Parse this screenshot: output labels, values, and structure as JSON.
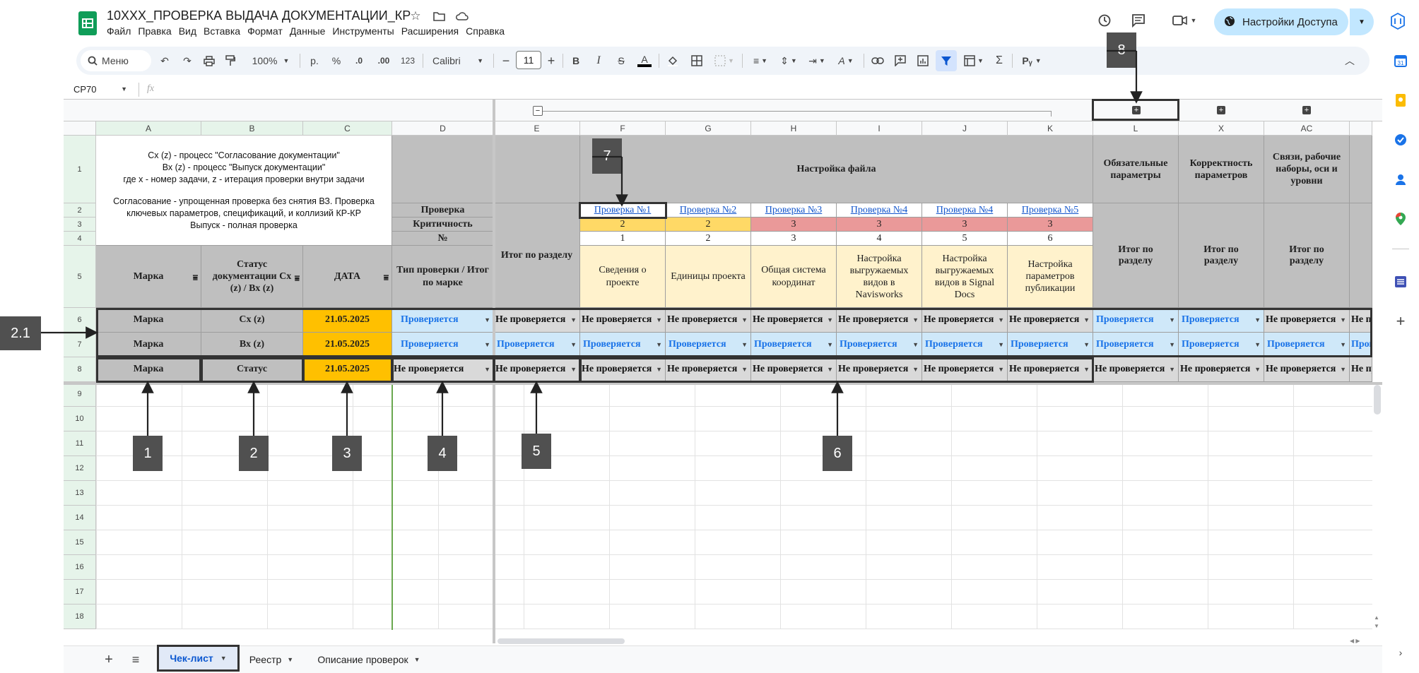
{
  "app": {
    "title": "10ХХХ_ПРОВЕРКА ВЫДАЧА ДОКУМЕНТАЦИИ_КР",
    "menu": [
      "Файл",
      "Правка",
      "Вид",
      "Вставка",
      "Формат",
      "Данные",
      "Инструменты",
      "Расширения",
      "Справка"
    ],
    "share_label": "Настройки Доступа",
    "colors": {
      "accent": "#1a73e8",
      "share_bg": "#c2e7ff",
      "sheets_green": "#0f9d58"
    }
  },
  "toolbar": {
    "search": "Меню",
    "zoom": "100%",
    "currency": "р.",
    "percent": "%",
    "dec_minus": ".0",
    "dec_plus": ".00",
    "num_format": "123",
    "font": "Calibri",
    "font_size": "11"
  },
  "formula_bar": {
    "cell_ref": "CP70",
    "fx": "fx"
  },
  "columns": [
    "A",
    "B",
    "C",
    "D",
    "E",
    "F",
    "G",
    "H",
    "I",
    "J",
    "K",
    "L",
    "X",
    "AC"
  ],
  "rows": [
    "1",
    "2",
    "3",
    "4",
    "5",
    "6",
    "7",
    "8",
    "9",
    "10",
    "11",
    "12",
    "13",
    "14",
    "15",
    "16",
    "17",
    "18"
  ],
  "legend": {
    "line1": "Сх (z) - процесс \"Согласование документации\"",
    "line2": "Вх (z) - процесс \"Выпуск документации\"",
    "line3": "где х - номер задачи, z - итерация проверки внутри задачи",
    "line4": "Согласование - упрощенная проверка без снятия ВЗ. Проверка ключевых параметров, спецификаций, и коллизий КР-КР",
    "line5": "Выпуск - полная проверка"
  },
  "labels": {
    "check": "Проверка",
    "criticality": "Критичность",
    "number": "№",
    "section_total": "Итог по разделу"
  },
  "headers": {
    "marka": "Марка",
    "status": "Статус документации Сх (z) / Вх (z)",
    "date": "ДАТА",
    "check_type": "Тип проверки / Итог по марке"
  },
  "section": {
    "file_setup": "Настройка файла",
    "required": "Обязательные параметры",
    "correct": "Корректность параметров",
    "links": "Связи, рабочие наборы, оси и уровни"
  },
  "checks": [
    {
      "link": "Проверка №1",
      "crit": "2",
      "num": "1",
      "name": "Сведения о проекте"
    },
    {
      "link": "Проверка №2",
      "crit": "2",
      "num": "2",
      "name": "Единицы проекта"
    },
    {
      "link": "Проверка №3",
      "crit": "3",
      "num": "3",
      "name": "Общая система координат"
    },
    {
      "link": "Проверка №4",
      "crit": "3",
      "num": "4",
      "name": "Настройка выгружаемых видов в Navisworks"
    },
    {
      "link": "Проверка №4",
      "crit": "3",
      "num": "5",
      "name": "Настройка выгружаемых видов в Signal Docs"
    },
    {
      "link": "Проверка №5",
      "crit": "3",
      "num": "6",
      "name": "Настройка параметров публикации"
    }
  ],
  "data_rows": [
    {
      "marka": "Марка",
      "status": "Сх (z)",
      "date": "21.05.2025",
      "values": [
        "Проверяется",
        "Не проверяется",
        "Не проверяется",
        "Не проверяется",
        "Не проверяется",
        "Не проверяется",
        "Не проверяется",
        "Не проверяется",
        "Проверяется",
        "Проверяется",
        "Не проверяется",
        "Не проверяется"
      ]
    },
    {
      "marka": "Марка",
      "status": "Вх (z)",
      "date": "21.05.2025",
      "values": [
        "Проверяется",
        "Проверяется",
        "Проверяется",
        "Проверяется",
        "Проверяется",
        "Проверяется",
        "Проверяется",
        "Проверяется",
        "Проверяется",
        "Проверяется",
        "Проверяется",
        "Проверяется"
      ]
    },
    {
      "marka": "Марка",
      "status": "Статус",
      "date": "21.05.2025",
      "values": [
        "Не проверяется",
        "Не проверяется",
        "Не проверяется",
        "Не проверяется",
        "Не проверяется",
        "Не проверяется",
        "Не проверяется",
        "Не проверяется",
        "Не проверяется",
        "Не проверяется",
        "Не проверяется",
        "Не проверяется"
      ]
    }
  ],
  "callouts": [
    "1",
    "2",
    "3",
    "4",
    "5",
    "6",
    "7",
    "8",
    "2.1"
  ],
  "tabs": [
    {
      "label": "Чек-лист",
      "active": true
    },
    {
      "label": "Реестр",
      "active": false
    },
    {
      "label": "Описание проверок",
      "active": false
    }
  ],
  "icons": [
    "sheets-logo-icon",
    "star-icon",
    "folder-icon",
    "cloud-icon",
    "history-icon",
    "comment-icon",
    "meet-icon",
    "globe-icon",
    "calendar-icon",
    "keep-icon",
    "tasks-icon",
    "contacts-icon",
    "maps-icon"
  ]
}
